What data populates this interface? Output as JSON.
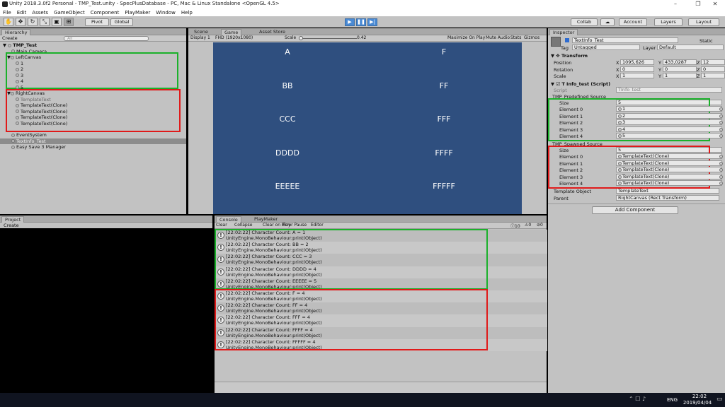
{
  "window": {
    "title": "Unity 2018.3.0f2 Personal - TMP_Test.unity - SpecPlusDatabase - PC, Mac & Linux Standalone <OpenGL 4.5>"
  },
  "menu": [
    "File",
    "Edit",
    "Assets",
    "GameObject",
    "Component",
    "PlayMaker",
    "Window",
    "Help"
  ],
  "toolbar": {
    "pivot": "Pivot",
    "global": "Global",
    "collab": "Collab",
    "account": "Account",
    "layers": "Layers",
    "layout": "Layout"
  },
  "hierarchy": {
    "tab": "Hierarchy",
    "create": "Create",
    "search_placeholder": "All",
    "scene": "TMP_Test",
    "main_camera": "Main Camera",
    "left_canvas": "LeftCanvas",
    "left_children": [
      "1",
      "2",
      "3",
      "4",
      "5"
    ],
    "right_canvas": "RightCanvas",
    "right_children": [
      "TemplateText",
      "TemplateText(Clone)",
      "TemplateText(Clone)",
      "TemplateText(Clone)",
      "TemplateText(Clone)"
    ],
    "event_system": "EventSystem",
    "textinfo": "TextInfo_Test",
    "easy_save": "Easy Save 3 Manager"
  },
  "center_tabs": {
    "scene": "Scene",
    "game": "Game",
    "asset_store": "Asset Store"
  },
  "game_toolbar": {
    "display": "Display 1",
    "resolution": "FHD (1920x1080)",
    "scale_label": "Scale",
    "scale_value": "0.42",
    "maximize": "Maximize On Play",
    "mute": "Mute Audio",
    "stats": "Stats",
    "gizmos": "Gizmos"
  },
  "game_left": [
    "A",
    "BB",
    "CCC",
    "DDDD",
    "EEEEE"
  ],
  "game_right": [
    "F",
    "FF",
    "FFF",
    "FFFF",
    "FFFFF"
  ],
  "project": {
    "tab": "Project",
    "create": "Create"
  },
  "console": {
    "tab": "Console",
    "playmaker_tab": "PlayMaker",
    "buttons": {
      "clear": "Clear",
      "collapse": "Collapse",
      "clear_on_play": "Clear on Play",
      "error_pause": "Error Pause",
      "editor": "Editor"
    },
    "counts": {
      "logs": "10",
      "warnings": "0",
      "errors": "0"
    },
    "entries": [
      {
        "line1": "[22:02:22] Character Count: A = 1",
        "line2": "UnityEngine.MonoBehaviour:print(Object)"
      },
      {
        "line1": "[22:02:22] Character Count: BB = 2",
        "line2": "UnityEngine.MonoBehaviour:print(Object)"
      },
      {
        "line1": "[22:02:22] Character Count: CCC = 3",
        "line2": "UnityEngine.MonoBehaviour:print(Object)"
      },
      {
        "line1": "[22:02:22] Character Count: DDDD = 4",
        "line2": "UnityEngine.MonoBehaviour:print(Object)"
      },
      {
        "line1": "[22:02:22] Character Count: EEEEE = 5",
        "line2": "UnityEngine.MonoBehaviour:print(Object)"
      },
      {
        "line1": "[22:02:22] Character Count: F = 4",
        "line2": "UnityEngine.MonoBehaviour:print(Object)"
      },
      {
        "line1": "[22:02:22] Character Count: FF = 4",
        "line2": "UnityEngine.MonoBehaviour:print(Object)"
      },
      {
        "line1": "[22:02:22] Character Count: FFF = 4",
        "line2": "UnityEngine.MonoBehaviour:print(Object)"
      },
      {
        "line1": "[22:02:22] Character Count: FFFF = 4",
        "line2": "UnityEngine.MonoBehaviour:print(Object)"
      },
      {
        "line1": "[22:02:22] Character Count: FFFFF = 4",
        "line2": "UnityEngine.MonoBehaviour:print(Object)"
      }
    ]
  },
  "inspector": {
    "tab": "Inspector",
    "object_name": "TextInfo_Test",
    "static": "Static",
    "tag_label": "Tag",
    "tag_value": "Untagged",
    "layer_label": "Layer",
    "layer_value": "Default",
    "transform": "Transform",
    "position_label": "Position",
    "position": {
      "x": "1095,626",
      "y": "433,0287",
      "z": "12"
    },
    "rotation_label": "Rotation",
    "rotation": {
      "x": "0",
      "y": "0",
      "z": "0"
    },
    "scale_label": "Scale",
    "scale": {
      "x": "1",
      "y": "1",
      "z": "1"
    },
    "script_component": "T Info_test (Script)",
    "script_label": "Script",
    "script_value": "TInfo_test",
    "predefined_label": "TMP_Predefined Source",
    "size_label": "Size",
    "predefined_size": "5",
    "predefined_elements": [
      {
        "label": "Element 0",
        "value": "1"
      },
      {
        "label": "Element 1",
        "value": "2"
      },
      {
        "label": "Element 2",
        "value": "3"
      },
      {
        "label": "Element 3",
        "value": "4"
      },
      {
        "label": "Element 4",
        "value": "5"
      }
    ],
    "spawned_label": "TMP_Spawned Source",
    "spawned_size": "5",
    "spawned_elements": [
      {
        "label": "Element 0",
        "value": "TemplateText(Clone)"
      },
      {
        "label": "Element 1",
        "value": "TemplateText(Clone)"
      },
      {
        "label": "Element 2",
        "value": "TemplateText(Clone)"
      },
      {
        "label": "Element 3",
        "value": "TemplateText(Clone)"
      },
      {
        "label": "Element 4",
        "value": "TemplateText(Clone)"
      }
    ],
    "template_label": "Template Object",
    "template_value": "TemplateText",
    "parent_label": "Parent",
    "parent_value": "RightCanvas (Rect Transform)",
    "add_component": "Add Component"
  },
  "taskbar": {
    "lang": "ENG",
    "time": "22:02",
    "date": "2019/04/04"
  },
  "colors": {
    "green_highlight": "#1bb12b",
    "red_highlight": "#e01a1a",
    "game_bg": "#2f4f7f"
  }
}
